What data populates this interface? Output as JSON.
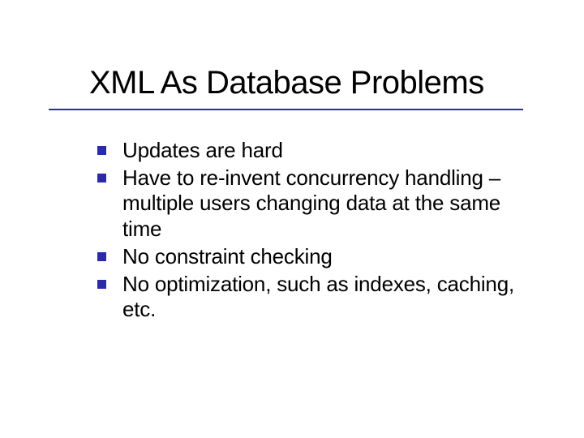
{
  "slide": {
    "title": "XML As Database Problems",
    "bullets": [
      {
        "text": "Updates are hard"
      },
      {
        "text": "Have to re-invent concurrency handling – multiple users changing data at the same time"
      },
      {
        "text": "No constraint checking"
      },
      {
        "text": "No optimization, such as indexes, caching, etc."
      }
    ],
    "accent_color": "#2b2ba8"
  }
}
